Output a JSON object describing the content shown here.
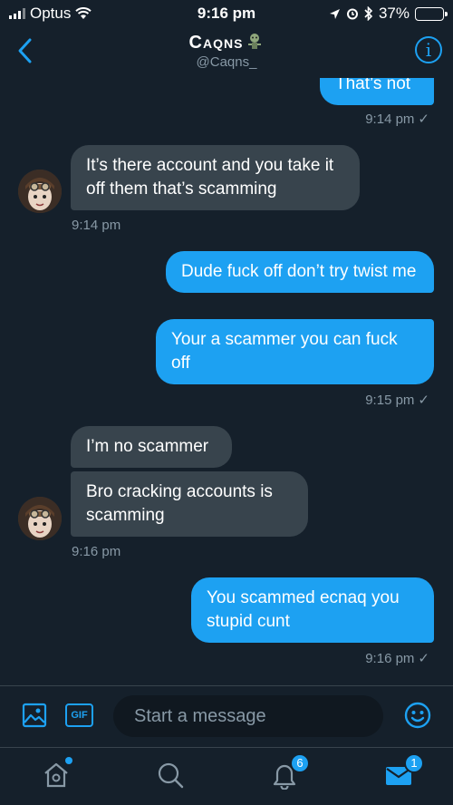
{
  "status_bar": {
    "carrier": "Optus",
    "time": "9:16 pm",
    "battery": "37%",
    "battery_level": 0.37
  },
  "header": {
    "name": "Caqns",
    "handle": "@Caqns_",
    "info_label": "i"
  },
  "messages": [
    {
      "from": "me",
      "text": "That’s not"
    },
    {
      "from": "me",
      "time": "9:14 pm"
    },
    {
      "from": "them",
      "text": "It’s there account and you take it off them that’s scamming",
      "time": "9:14 pm"
    },
    {
      "from": "me",
      "text": "Dude fuck off don’t try twist me"
    },
    {
      "from": "me",
      "text": "Your a scammer you can fuck off",
      "time": "9:15 pm"
    },
    {
      "from": "them",
      "text": "I’m no scammer"
    },
    {
      "from": "them",
      "text": "Bro cracking accounts is scamming",
      "time": "9:16 pm"
    },
    {
      "from": "me",
      "text": "You scammed ecnaq you stupid cunt",
      "time": "9:16 pm"
    }
  ],
  "read_mark": "✓",
  "composer": {
    "placeholder": "Start a message",
    "gif_label": "GIF"
  },
  "tabs": {
    "home": {
      "icon": "home-icon",
      "has_dot": true
    },
    "search": {
      "icon": "search-icon"
    },
    "notifications": {
      "icon": "bell-icon",
      "badge": "6"
    },
    "messages": {
      "icon": "envelope-icon",
      "badge": "1"
    }
  },
  "colors": {
    "background": "#15202b",
    "accent": "#1da1f2",
    "incoming_bubble": "#38444d",
    "muted_text": "#8899a6"
  }
}
